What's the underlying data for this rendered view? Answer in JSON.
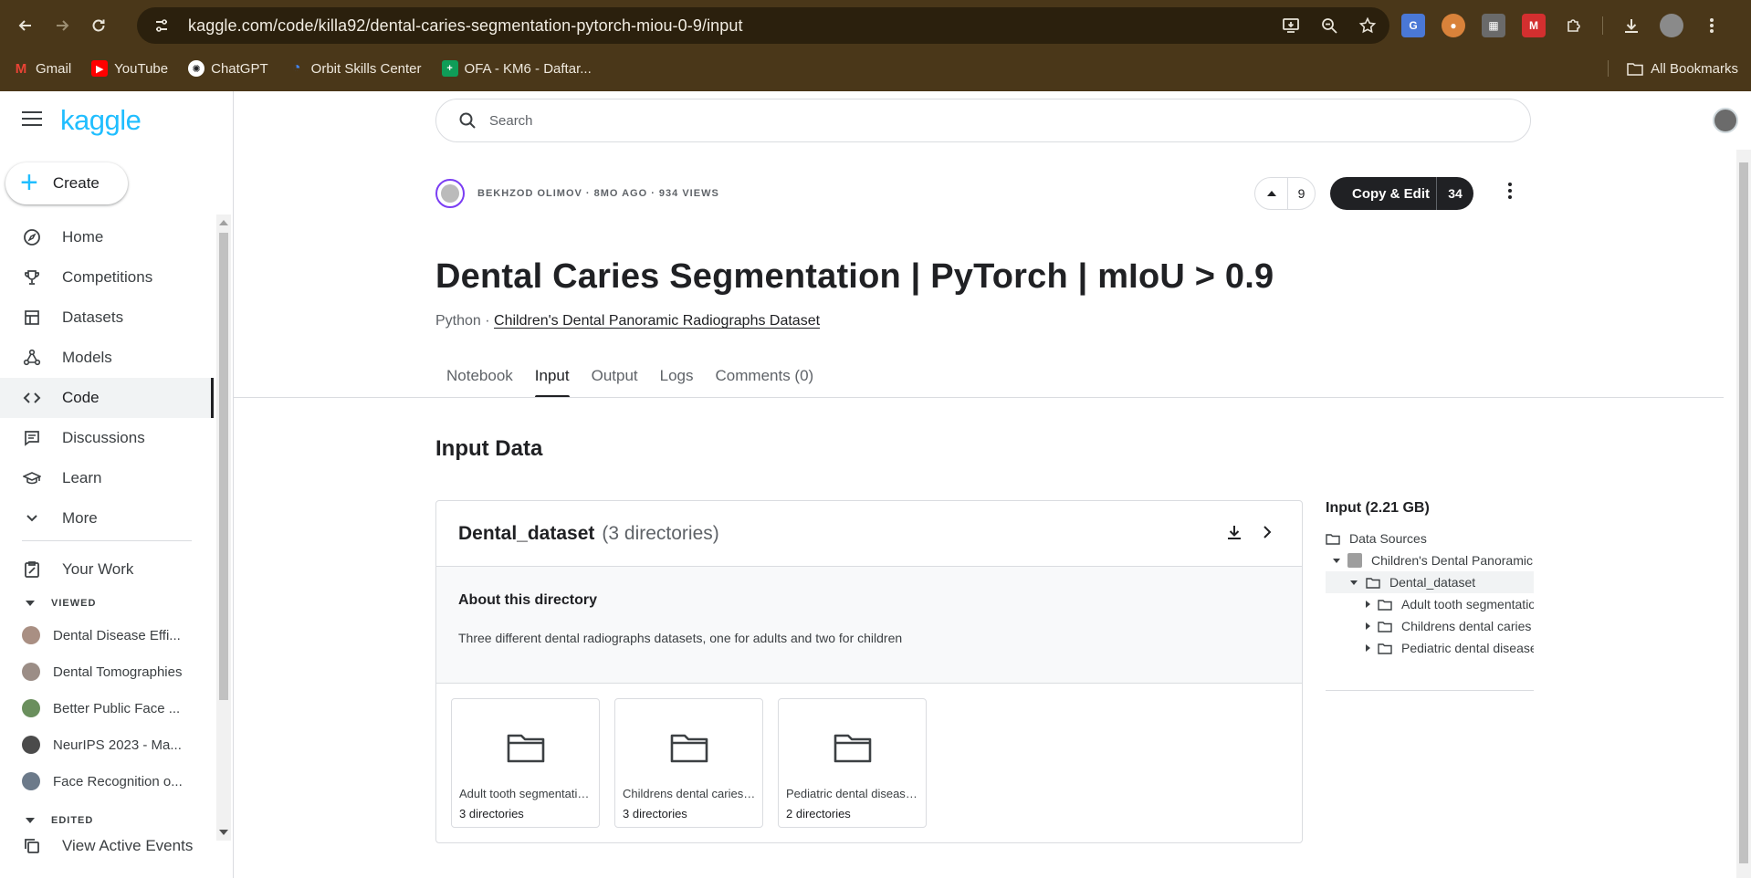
{
  "browser": {
    "url": "kaggle.com/code/killa92/dental-caries-segmentation-pytorch-miou-0-9/input",
    "bookmarks": [
      {
        "label": "Gmail",
        "icon": "gmail-icon",
        "color": "#ea4335"
      },
      {
        "label": "YouTube",
        "icon": "youtube-icon",
        "color": "#ff0000"
      },
      {
        "label": "ChatGPT",
        "icon": "chatgpt-icon",
        "color": "#ffffff"
      },
      {
        "label": "Orbit Skills Center",
        "icon": "orbit-icon",
        "color": "#4285f4"
      },
      {
        "label": "OFA - KM6 - Daftar...",
        "icon": "sheets-icon",
        "color": "#0f9d58"
      }
    ],
    "all_bookmarks": "All Bookmarks"
  },
  "sidebar": {
    "logo": "kaggle",
    "create": "Create",
    "nav": [
      {
        "label": "Home",
        "icon": "compass-icon"
      },
      {
        "label": "Competitions",
        "icon": "trophy-icon"
      },
      {
        "label": "Datasets",
        "icon": "table-icon"
      },
      {
        "label": "Models",
        "icon": "models-icon"
      },
      {
        "label": "Code",
        "icon": "code-icon",
        "active": true
      },
      {
        "label": "Discussions",
        "icon": "discussion-icon"
      },
      {
        "label": "Learn",
        "icon": "graduation-cap-icon"
      },
      {
        "label": "More",
        "icon": "chevron-down-icon"
      }
    ],
    "your_work": "Your Work",
    "viewed_label": "VIEWED",
    "viewed": [
      {
        "label": "Dental Disease Effi...",
        "color": "#a98f83"
      },
      {
        "label": "Dental Tomographies",
        "color": "#9b8d86"
      },
      {
        "label": "Better Public Face ...",
        "color": "#6a8f5d"
      },
      {
        "label": "NeurIPS 2023 - Ma...",
        "color": "#4b4b4b"
      },
      {
        "label": "Face Recognition o...",
        "color": "#6c7a8a"
      }
    ],
    "edited_label": "EDITED",
    "view_active_events": "View Active Events"
  },
  "search": {
    "placeholder": "Search"
  },
  "notebook": {
    "meta": "BEKHZOD OLIMOV · 8MO AGO · 934 VIEWS",
    "votes": "9",
    "copy_edit": "Copy & Edit",
    "copy_count": "34",
    "title": "Dental Caries Segmentation | PyTorch | mIoU > 0.9",
    "language": "Python · ",
    "dataset_link": "Children's Dental Panoramic Radiographs Dataset",
    "tabs": [
      "Notebook",
      "Input",
      "Output",
      "Logs",
      "Comments (0)"
    ],
    "active_tab": "Input"
  },
  "input": {
    "section_title": "Input Data",
    "card": {
      "name": "Dental_dataset",
      "sub": "(3 directories)",
      "about_title": "About this directory",
      "about_text": "Three different dental radiographs datasets, one for adults and two for children",
      "folders": [
        {
          "name": "Adult tooth segmentation dataset",
          "count": "3 directories"
        },
        {
          "name": "Childrens dental caries segmentation dataset",
          "count": "3 directories"
        },
        {
          "name": "Pediatric dental disease detection dataset",
          "count": "2 directories"
        }
      ]
    },
    "tree": {
      "title": "Input (2.21 GB)",
      "data_sources": "Data Sources",
      "dataset": "Children's Dental Panoramic Radiographs Dataset",
      "folder": "Dental_dataset",
      "children": [
        "Adult tooth segmentation dataset",
        "Childrens dental caries segmentation dataset",
        "Pediatric dental disease detection dataset"
      ]
    }
  }
}
